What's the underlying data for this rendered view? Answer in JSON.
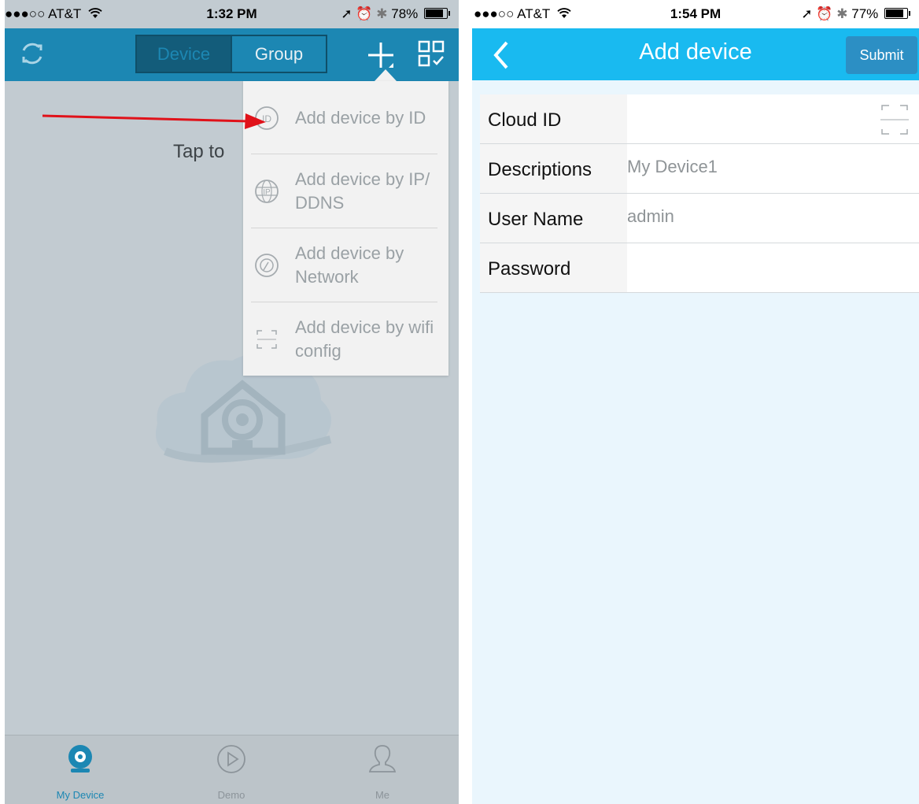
{
  "left": {
    "status": {
      "carrier": "●●●○○ AT&T",
      "time": "1:32 PM",
      "battery": "78%"
    },
    "header": {
      "tabs": [
        {
          "label": "Device",
          "active": true
        },
        {
          "label": "Group",
          "active": false
        }
      ]
    },
    "hint": "Tap to",
    "menu": {
      "items": [
        {
          "icon": "id-icon",
          "label": "Add device by ID"
        },
        {
          "icon": "globe-ip-icon",
          "label": "Add device by IP/ DDNS"
        },
        {
          "icon": "network-icon",
          "label": "Add device by Network"
        },
        {
          "icon": "scan-frame-icon",
          "label": "Add device by wifi config"
        }
      ]
    },
    "tabbar": {
      "items": [
        {
          "icon": "camera-icon",
          "label": "My Device",
          "active": true
        },
        {
          "icon": "play-icon",
          "label": "Demo",
          "active": false
        },
        {
          "icon": "person-icon",
          "label": "Me",
          "active": false
        }
      ]
    }
  },
  "right": {
    "status": {
      "carrier": "●●●○○ AT&T",
      "time": "1:54 PM",
      "battery": "77%"
    },
    "header": {
      "title": "Add device",
      "submit_label": "Submit"
    },
    "form": {
      "cloud_id_label": "Cloud ID",
      "cloud_id_value": "",
      "descriptions_label": "Descriptions",
      "descriptions_value": "My Device1",
      "username_label": "User Name",
      "username_value": "admin",
      "password_label": "Password",
      "password_value": ""
    }
  },
  "colors": {
    "header_left": "#1c87b3",
    "header_right": "#19baf0",
    "annotation": "#e0121a"
  }
}
